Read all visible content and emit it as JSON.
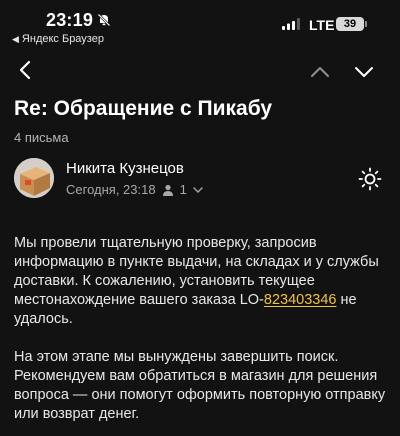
{
  "status_bar": {
    "time": "23:19",
    "back_app": "Яндекс Браузер",
    "network": "LTE",
    "battery": "39",
    "icons": [
      "bell-slash-icon",
      "cellular-signal-icon",
      "battery-icon"
    ]
  },
  "nav": {
    "icons": [
      "chevron-left-icon",
      "chevron-up-icon",
      "chevron-down-icon"
    ]
  },
  "email": {
    "subject": "Re: Обращение с Пикабу",
    "count": "4 письма",
    "sender": "Никита Кузнецов",
    "date": "Сегодня, 23:18",
    "recipients": "1",
    "body": {
      "p1_before": "Мы провели тщательную проверку, запросив информацию в пункте выдачи, на складах и у службы доставки. К сожалению, установить текущее местонахождение вашего заказа LO-",
      "order_number": "823403346",
      "p1_after": " не удалось.",
      "p2": "На этом этапе мы вынуждены завершить поиск. Рекомендуем вам обратиться в магазин для решения вопроса — они помогут оформить повторную отправку или возврат денег."
    }
  },
  "colors": {
    "background": "#121212",
    "link": "#f0c14b",
    "secondary_text": "#a8a8a8"
  }
}
